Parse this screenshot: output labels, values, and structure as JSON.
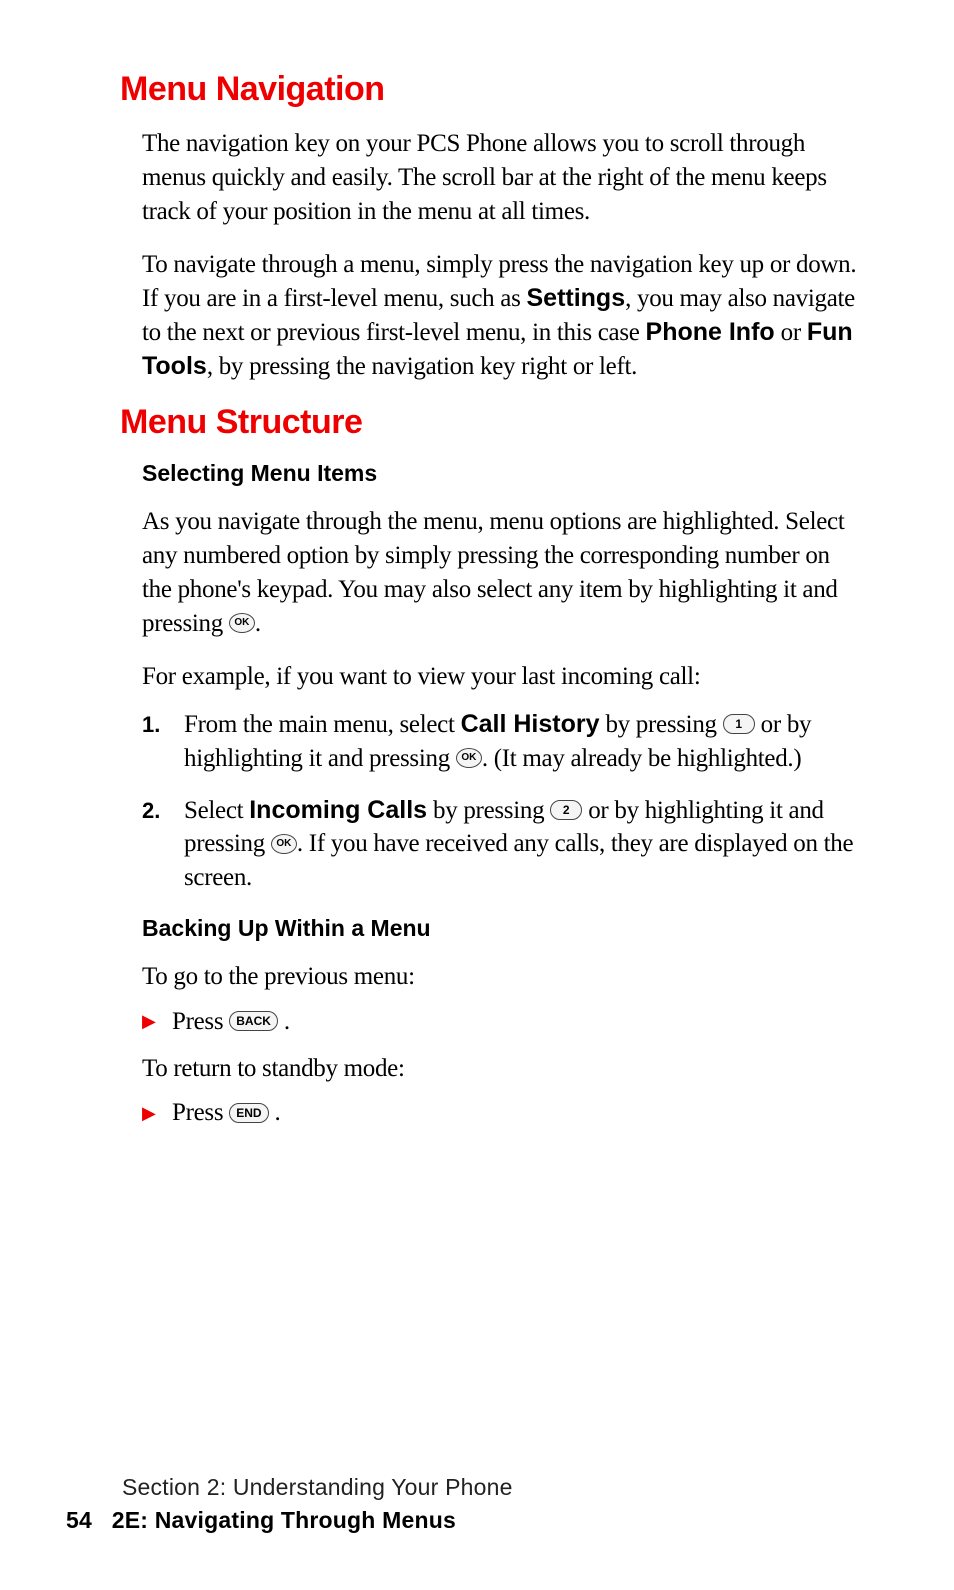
{
  "headings": {
    "h1": "Menu Navigation",
    "h2": "Menu Structure",
    "sub1": "Selecting Menu Items",
    "sub2": "Backing Up Within a Menu"
  },
  "nav": {
    "p1": "The navigation key on your PCS Phone allows you to scroll through menus quickly and easily. The scroll bar at the right of the menu keeps track of your position in the menu at all times.",
    "p2a": "To navigate through a menu, simply press the navigation key up or down. If you are in a first-level menu, such as ",
    "p2b_bold": "Settings",
    "p2c": ", you may also navigate to the next or previous first-level menu, in this case ",
    "p2d_bold": "Phone Info",
    "p2e": " or ",
    "p2f_bold": "Fun Tools",
    "p2g": ", by pressing the navigation key right or left."
  },
  "struct": {
    "p1a": "As you navigate through the menu, menu options are highlighted. Select any numbered option by simply pressing the corresponding number on the phone's keypad. You may also select any item by highlighting it and pressing ",
    "p1b": ".",
    "p2": "For example, if you want to view your last incoming call:",
    "li1a": "From the main menu, select ",
    "li1b_bold": "Call History",
    "li1c": " by pressing ",
    "li1d": " or by highlighting it and pressing ",
    "li1e": ". (It may already be highlighted.)",
    "li2a": "Select ",
    "li2b_bold": "Incoming Calls",
    "li2c": " by pressing ",
    "li2d": " or by highlighting it and pressing ",
    "li2e": ". If you have received any calls, they are displayed on the screen.",
    "back_p1": "To go to the previous menu:",
    "back_b1a": "Press ",
    "back_b1b": ".",
    "back_p2": "To return to standby mode:",
    "back_b2a": "Press ",
    "back_b2b": "."
  },
  "keys": {
    "ok": "OK",
    "one": "1",
    "two": "2",
    "back": "BACK",
    "end": "END"
  },
  "list_nums": {
    "one": "1.",
    "two": "2."
  },
  "footer": {
    "section": "Section 2: Understanding Your Phone",
    "page_num": "54",
    "chapter": "2E: Navigating Through Menus"
  },
  "bullet_glyph": "▶"
}
